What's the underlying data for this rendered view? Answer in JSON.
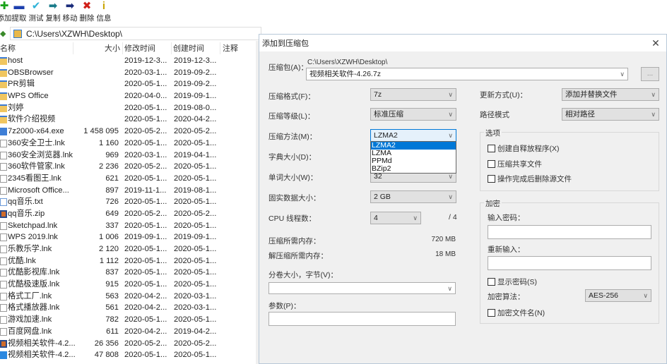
{
  "toolbar": {
    "buttons": [
      {
        "label": "添加",
        "icon": "plus-icon",
        "glyph": "✚",
        "color": "#1aa31a"
      },
      {
        "label": "提取",
        "icon": "minus-icon",
        "glyph": "▬",
        "color": "#1c3fae"
      },
      {
        "label": "测试",
        "icon": "check-icon",
        "glyph": "✔",
        "color": "#2fb3d8"
      },
      {
        "label": "复制",
        "icon": "copy-arrow-icon",
        "glyph": "➡",
        "color": "#1a7b8a"
      },
      {
        "label": "移动",
        "icon": "move-arrow-icon",
        "glyph": "➡",
        "color": "#1a2b7a"
      },
      {
        "label": "删除",
        "icon": "delete-x-icon",
        "glyph": "✖",
        "color": "#d0201a"
      },
      {
        "label": "信息",
        "icon": "info-icon",
        "glyph": "i",
        "color": "#c9a400"
      }
    ]
  },
  "address": {
    "path": "C:\\Users\\XZWH\\Desktop\\"
  },
  "file_list": {
    "columns": {
      "name": "名称",
      "size": "大小",
      "modified": "修改时间",
      "created": "创建时间",
      "comment": "注释"
    },
    "rows": [
      {
        "name": "host",
        "size": "",
        "modified": "2019-12-3...",
        "created": "2019-12-3...",
        "type": "folder"
      },
      {
        "name": "OBSBrowser",
        "size": "",
        "modified": "2020-03-1...",
        "created": "2019-09-2...",
        "type": "folder"
      },
      {
        "name": "PR剪辑",
        "size": "",
        "modified": "2020-05-1...",
        "created": "2019-09-2...",
        "type": "folder"
      },
      {
        "name": "WPS Office",
        "size": "",
        "modified": "2020-04-0...",
        "created": "2019-09-1...",
        "type": "folder"
      },
      {
        "name": "刘婷",
        "size": "",
        "modified": "2020-05-1...",
        "created": "2019-08-0...",
        "type": "folder"
      },
      {
        "name": "软件介绍视频",
        "size": "",
        "modified": "2020-05-1...",
        "created": "2020-04-2...",
        "type": "folder"
      },
      {
        "name": "7z2000-x64.exe",
        "size": "1 458 095",
        "modified": "2020-05-2...",
        "created": "2020-05-2...",
        "type": "exe"
      },
      {
        "name": "360安全卫士.lnk",
        "size": "1 160",
        "modified": "2020-05-1...",
        "created": "2020-05-1...",
        "type": "lnk"
      },
      {
        "name": "360安全浏览器.lnk",
        "size": "969",
        "modified": "2020-03-1...",
        "created": "2019-04-1...",
        "type": "lnk"
      },
      {
        "name": "360软件管家.lnk",
        "size": "2 236",
        "modified": "2020-05-2...",
        "created": "2020-05-1...",
        "type": "lnk"
      },
      {
        "name": "2345看图王.lnk",
        "size": "621",
        "modified": "2020-05-1...",
        "created": "2020-05-1...",
        "type": "lnk"
      },
      {
        "name": "Microsoft Office...",
        "size": "897",
        "modified": "2019-11-1...",
        "created": "2019-08-1...",
        "type": "lnk"
      },
      {
        "name": "qq音乐.txt",
        "size": "726",
        "modified": "2020-05-1...",
        "created": "2020-05-1...",
        "type": "txt"
      },
      {
        "name": "qq音乐.zip",
        "size": "649",
        "modified": "2020-05-2...",
        "created": "2020-05-2...",
        "type": "zip"
      },
      {
        "name": "Sketchpad.lnk",
        "size": "337",
        "modified": "2020-05-1...",
        "created": "2020-05-1...",
        "type": "lnk"
      },
      {
        "name": "WPS 2019.lnk",
        "size": "1 006",
        "modified": "2019-09-1...",
        "created": "2019-09-1...",
        "type": "lnk"
      },
      {
        "name": "乐教乐学.lnk",
        "size": "2 120",
        "modified": "2020-05-1...",
        "created": "2020-05-1...",
        "type": "lnk"
      },
      {
        "name": "优酷.lnk",
        "size": "1 112",
        "modified": "2020-05-1...",
        "created": "2020-05-1...",
        "type": "lnk"
      },
      {
        "name": "优酷影视库.lnk",
        "size": "837",
        "modified": "2020-05-1...",
        "created": "2020-05-1...",
        "type": "lnk"
      },
      {
        "name": "优酷极速版.lnk",
        "size": "915",
        "modified": "2020-05-1...",
        "created": "2020-05-1...",
        "type": "lnk"
      },
      {
        "name": "格式工厂.lnk",
        "size": "563",
        "modified": "2020-04-2...",
        "created": "2020-03-1...",
        "type": "lnk"
      },
      {
        "name": "格式播放器.lnk",
        "size": "561",
        "modified": "2020-04-2...",
        "created": "2020-03-1...",
        "type": "lnk"
      },
      {
        "name": "游戏加速.lnk",
        "size": "782",
        "modified": "2020-05-1...",
        "created": "2020-05-1...",
        "type": "lnk"
      },
      {
        "name": "百度网盘.lnk",
        "size": "611",
        "modified": "2020-04-2...",
        "created": "2019-04-2...",
        "type": "lnk"
      },
      {
        "name": "视频相关软件-4.2...",
        "size": "26 356",
        "modified": "2020-05-2...",
        "created": "2020-05-2...",
        "type": "zip"
      },
      {
        "name": "视频相关软件-4.2...",
        "size": "47 808",
        "modified": "2020-05-1...",
        "created": "2020-05-1...",
        "type": "rar"
      }
    ]
  },
  "dialog": {
    "title": "添加到压缩包",
    "close": "✕",
    "archive_label": "压缩包(A)：",
    "archive_dir": "C:\\Users\\XZWH\\Desktop\\",
    "archive_name": "视频相关软件-4.26.7z",
    "browse_label": "...",
    "format_label": "压缩格式(F)：",
    "format_value": "7z",
    "level_label": "压缩等级(L)：",
    "level_value": "标准压缩",
    "method_label": "压缩方法(M)：",
    "method_value": "LZMA2",
    "method_options": [
      "LZMA2",
      "LZMA",
      "PPMd",
      "BZip2"
    ],
    "method_selected_index": 0,
    "dict_label": "字典大小(D)：",
    "word_label": "单词大小(W)：",
    "word_value": "32",
    "solid_label": "固实数据大小：",
    "solid_value": "2 GB",
    "cpu_label": "CPU 线程数：",
    "cpu_value": "4",
    "cpu_max": "/ 4",
    "mem_compress_label": "压缩所需内存：",
    "mem_compress_value": "720 MB",
    "mem_decompress_label": "解压缩所需内存：",
    "mem_decompress_value": "18 MB",
    "volume_label": "分卷大小，字节(V)：",
    "volume_value": "",
    "params_label": "参数(P)：",
    "params_value": "",
    "update_label": "更新方式(U)：",
    "update_value": "添加并替换文件",
    "path_label": "路径模式",
    "path_value": "相对路径",
    "options": {
      "title": "选项",
      "items": [
        {
          "label": "创建自释放程序(X)",
          "checked": false
        },
        {
          "label": "压缩共享文件",
          "checked": false
        },
        {
          "label": "操作完成后删除源文件",
          "checked": false
        }
      ]
    },
    "encryption": {
      "title": "加密",
      "password_label": "输入密码：",
      "password_value": "",
      "reenter_label": "重新输入：",
      "reenter_value": "",
      "show_password": {
        "label": "显示密码(S)",
        "checked": false
      },
      "method_label": "加密算法：",
      "method_value": "AES-256",
      "encrypt_names": {
        "label": "加密文件名(N)",
        "checked": false
      }
    }
  }
}
